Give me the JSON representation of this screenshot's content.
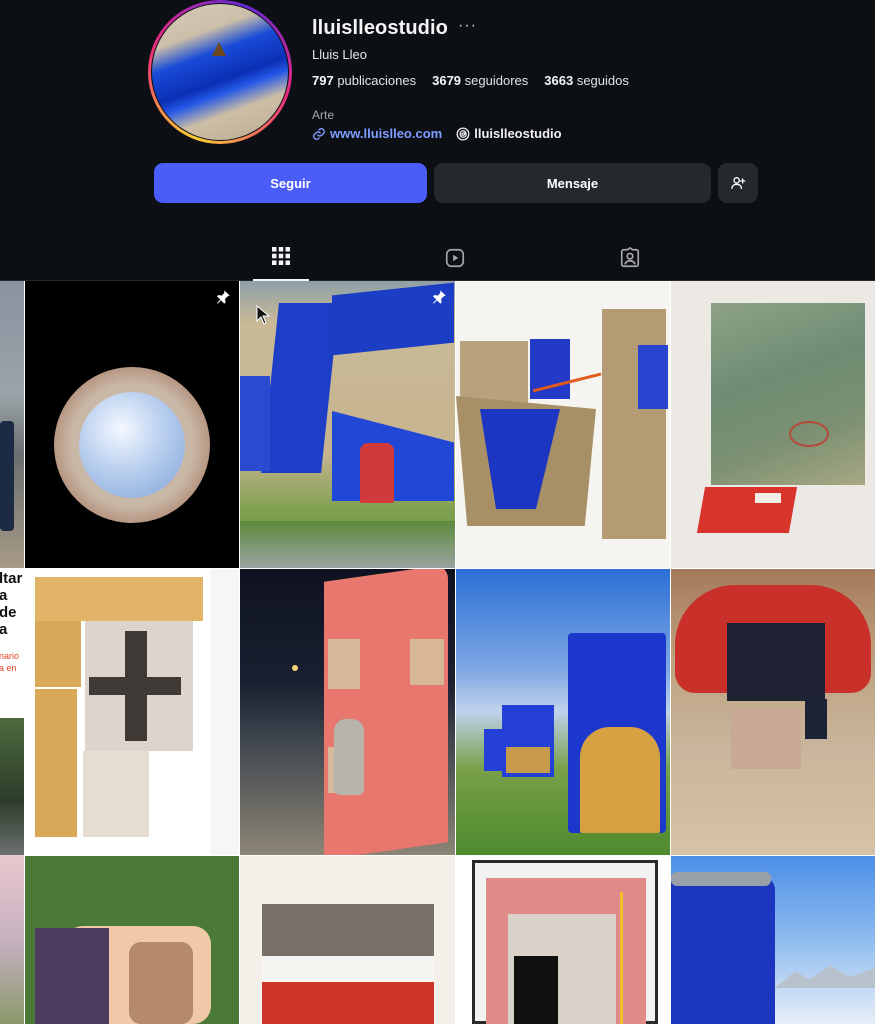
{
  "profile": {
    "username": "lluislleostudio",
    "more": "···",
    "full_name": "Lluis Lleo",
    "stats": [
      {
        "value": "797",
        "label": "publicaciones"
      },
      {
        "value": "3679",
        "label": "seguidores"
      },
      {
        "value": "3663",
        "label": "seguidos"
      }
    ],
    "category": "Arte",
    "website": "www.lluislleo.com",
    "threads": "lluislleostudio"
  },
  "actions": {
    "follow": "Seguir",
    "message": "Mensaje"
  },
  "tabs": [
    "posts",
    "reels",
    "tagged"
  ],
  "side_fragment": {
    "line1": "ltar",
    "line2": "a de",
    "line3": "a",
    "red1": "nario",
    "red2": "a en"
  },
  "colors": {
    "background": "#0c0f14",
    "follow_button": "#4a5df9",
    "secondary_button": "#25292e",
    "link": "#7f9cff"
  }
}
